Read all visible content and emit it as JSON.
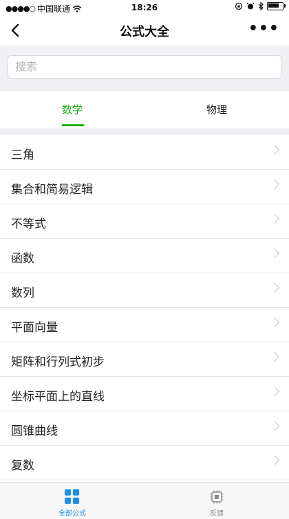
{
  "status": {
    "carrier": "中国联通",
    "time": "18:26",
    "battery_level": 0.85
  },
  "nav": {
    "title": "公式大全",
    "more_label": "•••"
  },
  "search": {
    "placeholder": "搜索"
  },
  "tabs": [
    {
      "label": "数学",
      "active": true
    },
    {
      "label": "物理",
      "active": false
    }
  ],
  "list": {
    "items": [
      "三角",
      "集合和简易逻辑",
      "不等式",
      "函数",
      "数列",
      "平面向量",
      "矩阵和行列式初步",
      "坐标平面上的直线",
      "圆锥曲线",
      "复数"
    ]
  },
  "tabbar": {
    "items": [
      {
        "label": "全部公式",
        "icon": "grid-icon",
        "active": true
      },
      {
        "label": "反馈",
        "icon": "chip-icon",
        "active": false
      }
    ]
  },
  "colors": {
    "accent": "#1aad19",
    "tabbar_active": "#1a8fe6",
    "background": "#efeff4"
  }
}
